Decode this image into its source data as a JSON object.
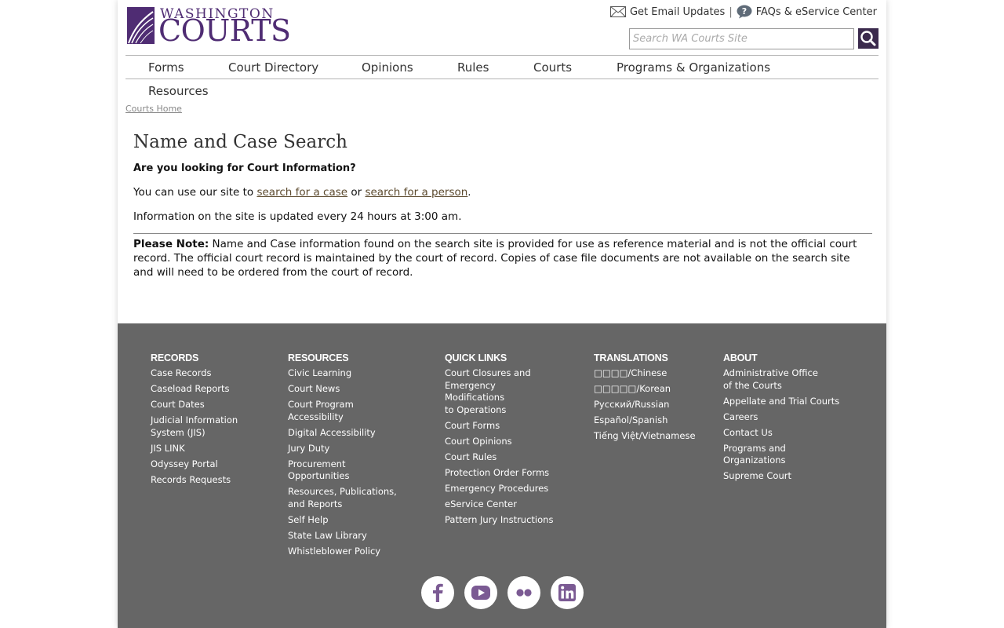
{
  "header": {
    "logo_top": "WASHINGTON",
    "logo_main": "COURTS",
    "email_updates": "Get Email Updates",
    "separator": "|",
    "faqs": "FAQs & eService Center",
    "search_placeholder": "Search WA Courts Site"
  },
  "nav": {
    "items": [
      "Forms",
      "Court Directory",
      "Opinions",
      "Rules",
      "Courts",
      "Programs & Organizations",
      "Resources"
    ]
  },
  "breadcrumb": "Courts Home",
  "main": {
    "title": "Name and Case Search",
    "lead": "Are you looking for Court Information?",
    "search_text_pre": "You can use our site to ",
    "search_case_link": "search for a case",
    "search_text_mid": " or ",
    "search_person_link": "search for a person",
    "search_text_post": ".",
    "update_info": "Information on the site is updated every 24 hours at 3:00 am.",
    "note_label": "Please Note:",
    "note_text": " Name and Case information found on the search site is provided for use as reference material and is not the official court record. The official court record is maintained by the court of record. Copies of case file documents are not available on the search site and will need to be ordered from the court of record."
  },
  "footer": {
    "records": {
      "heading": "RECORDS",
      "links": [
        "Case Records",
        "Caseload Reports",
        "Court Dates",
        "Judicial Information\nSystem (JIS)",
        "JIS LINK",
        "Odyssey Portal",
        "Records Requests"
      ]
    },
    "resources": {
      "heading": "RESOURCES",
      "links": [
        "Civic Learning",
        "Court News",
        "Court Program\nAccessibility",
        "Digital Accessibility",
        "Jury Duty",
        "Procurement\nOpportunities",
        "Resources, Publications,\nand Reports",
        "Self Help",
        "State Law Library",
        "Whistleblower Policy"
      ]
    },
    "quick_links": {
      "heading": "QUICK LINKS",
      "links": [
        "Court Closures and\n  Emergency\nModifications\n  to Operations",
        "Court Forms",
        "Court Opinions",
        "Court Rules",
        "Protection Order Forms",
        "Emergency Procedures",
        "eService Center",
        "Pattern Jury Instructions"
      ]
    },
    "translations": {
      "heading": "TRANSLATIONS",
      "links": [
        "□□□□/Chinese",
        "□□□□□/Korean",
        "Русский/Russian",
        "Español/Spanish",
        "Tiếng Việt/Vietnamese"
      ]
    },
    "about": {
      "heading": "ABOUT",
      "links": [
        "Administrative Office\nof the Courts",
        "Appellate and Trial Courts",
        "Careers",
        "Contact Us",
        "Programs and\nOrganizations",
        "Supreme Court"
      ]
    },
    "social": [
      "facebook-icon",
      "youtube-icon",
      "flickr-icon",
      "linkedin-icon"
    ]
  },
  "colors": {
    "brand_purple": "#4f2c73",
    "footer_bg": "#666666",
    "search_button": "#3b2a4d",
    "social_purple": "#7b5a93"
  }
}
